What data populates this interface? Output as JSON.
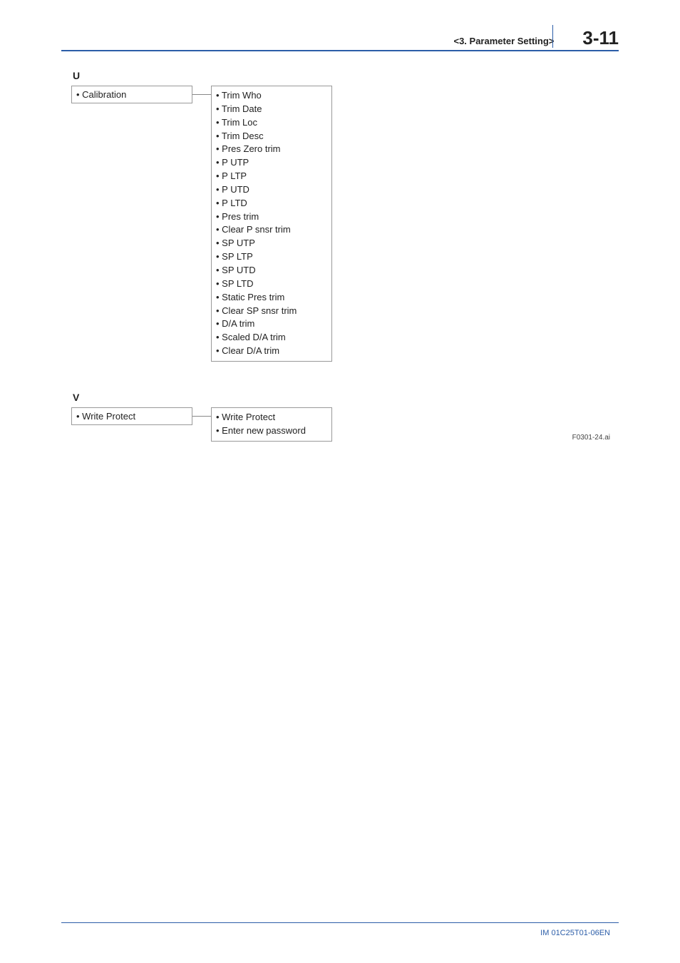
{
  "header": {
    "breadcrumb": "<3.  Parameter Setting>",
    "page_number": "3-11"
  },
  "sections": {
    "u": {
      "label": "U",
      "parent": "• Calibration",
      "children": [
        "• Trim Who",
        "• Trim Date",
        "• Trim Loc",
        "• Trim Desc",
        "• Pres Zero trim",
        "• P UTP",
        "• P LTP",
        "• P UTD",
        "• P LTD",
        "• Pres trim",
        "• Clear P snsr trim",
        "• SP UTP",
        "• SP LTP",
        "• SP UTD",
        "• SP LTD",
        "• Static Pres trim",
        "• Clear SP snsr trim",
        "• D/A trim",
        "• Scaled D/A trim",
        "• Clear D/A trim"
      ]
    },
    "v": {
      "label": "V",
      "parent": "• Write Protect",
      "children": [
        "• Write Protect",
        "• Enter new password"
      ]
    }
  },
  "figure_ref": "F0301-24.ai",
  "footer": "IM 01C25T01-06EN"
}
